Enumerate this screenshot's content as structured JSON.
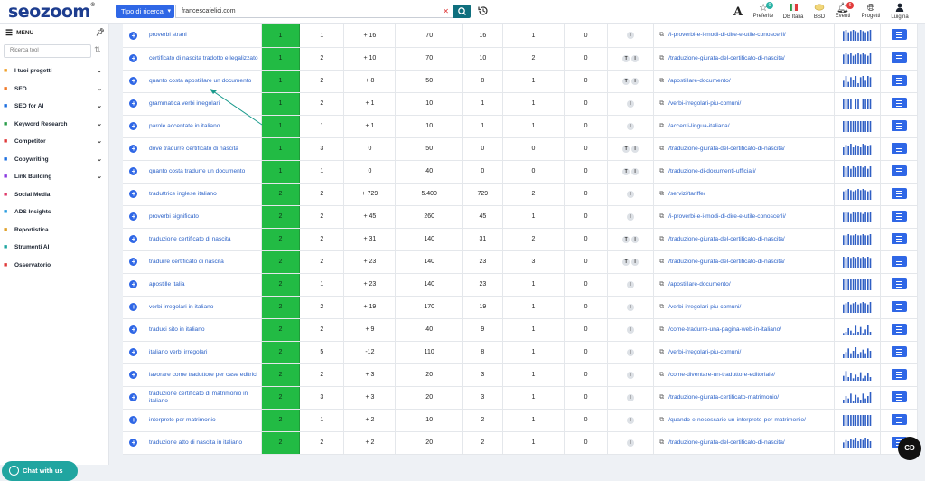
{
  "app": {
    "logo": "seozoom",
    "logo_mark": "®"
  },
  "search": {
    "type_label": "Tipo di ricerca",
    "query": "francescafelici.com"
  },
  "top_icons": [
    {
      "label": "Preferite",
      "badge": "0",
      "badge_color": "#2ab3a6",
      "icon": "star-icon"
    },
    {
      "label": "DB Italia",
      "icon": "italy-flag-icon"
    },
    {
      "label": "BSD",
      "icon": "bsd-icon"
    },
    {
      "label": "Eventi",
      "badge": "6",
      "badge_color": "#e23b3b",
      "icon": "bell-icon"
    },
    {
      "label": "Progetti",
      "icon": "globe-icon"
    },
    {
      "label": "Luigina",
      "icon": "user-icon"
    }
  ],
  "sidebar": {
    "menu_label": "MENU",
    "tool_search_placeholder": "Ricerca tool",
    "items": [
      {
        "label": "I tuoi progetti",
        "icon": "projects-icon",
        "color": "#f0a02a",
        "chevron": true
      },
      {
        "label": "SEO",
        "icon": "seo-chart-icon",
        "color": "#f07a2a",
        "chevron": true
      },
      {
        "label": "SEO for AI",
        "icon": "seo-ai-icon",
        "color": "#1d6fe0",
        "chevron": true
      },
      {
        "label": "Keyword Research",
        "icon": "key-icon",
        "color": "#2a9d4a",
        "chevron": true
      },
      {
        "label": "Competitor",
        "icon": "competitor-icon",
        "color": "#e03a3a",
        "chevron": true
      },
      {
        "label": "Copywriting",
        "icon": "pencil-icon",
        "color": "#1d6fe0",
        "chevron": true
      },
      {
        "label": "Link Building",
        "icon": "link-icon",
        "color": "#8a3ae0",
        "chevron": true
      },
      {
        "label": "Social Media",
        "icon": "social-icon",
        "color": "#e03a6a",
        "chevron": false
      },
      {
        "label": "ADS Insights",
        "icon": "ads-icon",
        "color": "#2a9de0",
        "chevron": false
      },
      {
        "label": "Reportistica",
        "icon": "report-icon",
        "color": "#e0a02a",
        "chevron": false
      },
      {
        "label": "Strumenti AI",
        "icon": "ai-tools-icon",
        "color": "#20a5a0",
        "chevron": false
      },
      {
        "label": "Osservatorio",
        "icon": "observatory-icon",
        "color": "#e03a3a",
        "chevron": false
      }
    ]
  },
  "chat_label": "Chat with us",
  "corner_badge": "CD",
  "rows": [
    {
      "keyword": "proverbi strani",
      "pos": "1",
      "c1": "1",
      "var": "+ 16",
      "vol": "70",
      "traffic": "16",
      "c5": "1",
      "c6": "0",
      "tags": [
        "I"
      ],
      "url": "/i-proverbi-e-i-modi-di-dire-e-utile-conoscerli/",
      "spark": [
        8,
        9,
        7,
        8,
        9,
        8,
        7,
        9,
        8,
        7,
        8,
        9
      ]
    },
    {
      "keyword": "certificato di nascita tradotto e legalizzato",
      "pos": "1",
      "c1": "2",
      "var": "+ 10",
      "vol": "70",
      "traffic": "10",
      "c5": "2",
      "c6": "0",
      "tags": [
        "T",
        "I"
      ],
      "url": "/traduzione-giurata-del-certificato-di-nascita/",
      "spark": [
        8,
        9,
        8,
        9,
        7,
        8,
        9,
        8,
        9,
        8,
        7,
        9
      ]
    },
    {
      "keyword": "quanto costa apostillare un documento",
      "pos": "1",
      "c1": "2",
      "var": "+ 8",
      "vol": "50",
      "traffic": "8",
      "c5": "1",
      "c6": "0",
      "tags": [
        "T",
        "I"
      ],
      "url": "/apostillare-documento/",
      "spark": [
        5,
        9,
        4,
        8,
        6,
        9,
        3,
        8,
        9,
        5,
        9,
        8
      ]
    },
    {
      "keyword": "grammatica verbi irregolari",
      "pos": "1",
      "c1": "2",
      "var": "+ 1",
      "vol": "10",
      "traffic": "1",
      "c5": "1",
      "c6": "0",
      "tags": [
        "I"
      ],
      "url": "/verbi-irregolari-piu-comuni/",
      "spark": [
        9,
        9,
        9,
        9,
        0,
        9,
        9,
        0,
        9,
        9,
        9,
        9
      ]
    },
    {
      "keyword": "parole accentate in italiano",
      "pos": "1",
      "c1": "1",
      "var": "+ 1",
      "vol": "10",
      "traffic": "1",
      "c5": "1",
      "c6": "0",
      "tags": [
        "I"
      ],
      "url": "/accenti-lingua-italiana/",
      "spark": [
        9,
        9,
        9,
        9,
        9,
        9,
        9,
        9,
        9,
        9,
        9,
        9
      ]
    },
    {
      "keyword": "dove tradurre certificato di nascita",
      "pos": "1",
      "c1": "3",
      "var": "0",
      "vol": "50",
      "traffic": "0",
      "c5": "0",
      "c6": "0",
      "tags": [
        "T",
        "I"
      ],
      "url": "/traduzione-giurata-del-certificato-di-nascita/",
      "spark": [
        6,
        8,
        7,
        9,
        6,
        8,
        7,
        6,
        9,
        8,
        7,
        8
      ]
    },
    {
      "keyword": "quanto costa tradurre un documento",
      "pos": "1",
      "c1": "1",
      "var": "0",
      "vol": "40",
      "traffic": "0",
      "c5": "0",
      "c6": "0",
      "tags": [
        "T",
        "I"
      ],
      "url": "/traduzione-di-documenti-ufficiali/",
      "spark": [
        9,
        8,
        9,
        7,
        9,
        8,
        9,
        9,
        8,
        9,
        7,
        9
      ]
    },
    {
      "keyword": "traduttrice inglese italiano",
      "pos": "2",
      "c1": "2",
      "var": "+ 729",
      "vol": "5.400",
      "traffic": "729",
      "c5": "2",
      "c6": "0",
      "tags": [
        "I"
      ],
      "url": "/servizi/tariffe/",
      "spark": [
        7,
        8,
        9,
        8,
        7,
        8,
        9,
        8,
        9,
        8,
        7,
        8
      ]
    },
    {
      "keyword": "proverbi significato",
      "pos": "2",
      "c1": "2",
      "var": "+ 45",
      "vol": "260",
      "traffic": "45",
      "c5": "1",
      "c6": "0",
      "tags": [
        "I"
      ],
      "url": "/i-proverbi-e-i-modi-di-dire-e-utile-conoscerli/",
      "spark": [
        8,
        9,
        8,
        7,
        9,
        8,
        9,
        8,
        7,
        9,
        8,
        9
      ]
    },
    {
      "keyword": "traduzione certificato di nascita",
      "pos": "2",
      "c1": "2",
      "var": "+ 31",
      "vol": "140",
      "traffic": "31",
      "c5": "2",
      "c6": "0",
      "tags": [
        "T",
        "I"
      ],
      "url": "/traduzione-giurata-del-certificato-di-nascita/",
      "spark": [
        8,
        8,
        9,
        8,
        8,
        9,
        8,
        8,
        9,
        8,
        8,
        9
      ]
    },
    {
      "keyword": "tradurre certificato di nascita",
      "pos": "2",
      "c1": "2",
      "var": "+ 23",
      "vol": "140",
      "traffic": "23",
      "c5": "3",
      "c6": "0",
      "tags": [
        "T",
        "I"
      ],
      "url": "/traduzione-giurata-del-certificato-di-nascita/",
      "spark": [
        9,
        8,
        9,
        8,
        9,
        8,
        9,
        8,
        9,
        8,
        9,
        8
      ]
    },
    {
      "keyword": "apostille italia",
      "pos": "2",
      "c1": "1",
      "var": "+ 23",
      "vol": "140",
      "traffic": "23",
      "c5": "1",
      "c6": "0",
      "tags": [
        "I"
      ],
      "url": "/apostillare-documento/",
      "spark": [
        9,
        9,
        9,
        9,
        9,
        9,
        9,
        9,
        9,
        9,
        9,
        9
      ]
    },
    {
      "keyword": "verbi irregolari in italiano",
      "pos": "2",
      "c1": "2",
      "var": "+ 19",
      "vol": "170",
      "traffic": "19",
      "c5": "1",
      "c6": "0",
      "tags": [
        "I"
      ],
      "url": "/verbi-irregolari-piu-comuni/",
      "spark": [
        7,
        8,
        9,
        7,
        8,
        9,
        7,
        8,
        9,
        8,
        7,
        9
      ]
    },
    {
      "keyword": "traduci sito in italiano",
      "pos": "2",
      "c1": "2",
      "var": "+ 9",
      "vol": "40",
      "traffic": "9",
      "c5": "1",
      "c6": "0",
      "tags": [
        "I"
      ],
      "url": "/come-tradurre-una-pagina-web-in-italiano/",
      "spark": [
        2,
        3,
        6,
        4,
        2,
        8,
        3,
        7,
        2,
        5,
        9,
        3
      ]
    },
    {
      "keyword": "italiano verbi irregolari",
      "pos": "2",
      "c1": "5",
      "var": "-12",
      "vol": "110",
      "traffic": "8",
      "c5": "1",
      "c6": "0",
      "tags": [
        "I"
      ],
      "url": "/verbi-irregolari-piu-comuni/",
      "spark": [
        3,
        5,
        8,
        4,
        6,
        9,
        3,
        5,
        7,
        4,
        8,
        6
      ]
    },
    {
      "keyword": "lavorare come traduttore per case editrici",
      "pos": "2",
      "c1": "2",
      "var": "+ 3",
      "vol": "20",
      "traffic": "3",
      "c5": "1",
      "c6": "0",
      "tags": [
        "I"
      ],
      "url": "/come-diventare-un-traduttore-editoriale/",
      "spark": [
        4,
        8,
        3,
        6,
        2,
        5,
        3,
        7,
        2,
        4,
        6,
        3
      ]
    },
    {
      "keyword": "traduzione certificato di matrimonio in italiano",
      "pos": "2",
      "c1": "3",
      "var": "+ 3",
      "vol": "20",
      "traffic": "3",
      "c5": "1",
      "c6": "0",
      "tags": [
        "I"
      ],
      "url": "/traduzione-giurata-certificato-matrimonio/",
      "spark": [
        3,
        6,
        4,
        8,
        2,
        7,
        5,
        3,
        8,
        4,
        6,
        9
      ]
    },
    {
      "keyword": "interprete per matrimonio",
      "pos": "2",
      "c1": "1",
      "var": "+ 2",
      "vol": "10",
      "traffic": "2",
      "c5": "1",
      "c6": "0",
      "tags": [
        "I"
      ],
      "url": "/quando-e-necessario-un-interprete-per-matrimonio/",
      "spark": [
        9,
        9,
        9,
        9,
        9,
        9,
        9,
        9,
        9,
        9,
        9,
        9
      ]
    },
    {
      "keyword": "traduzione atto di nascita in italiano",
      "pos": "2",
      "c1": "2",
      "var": "+ 2",
      "vol": "20",
      "traffic": "2",
      "c5": "1",
      "c6": "0",
      "tags": [
        "I"
      ],
      "url": "/traduzione-giurata-del-certificato-di-nascita/",
      "spark": [
        5,
        7,
        6,
        8,
        7,
        9,
        6,
        8,
        7,
        9,
        8,
        6
      ]
    }
  ]
}
